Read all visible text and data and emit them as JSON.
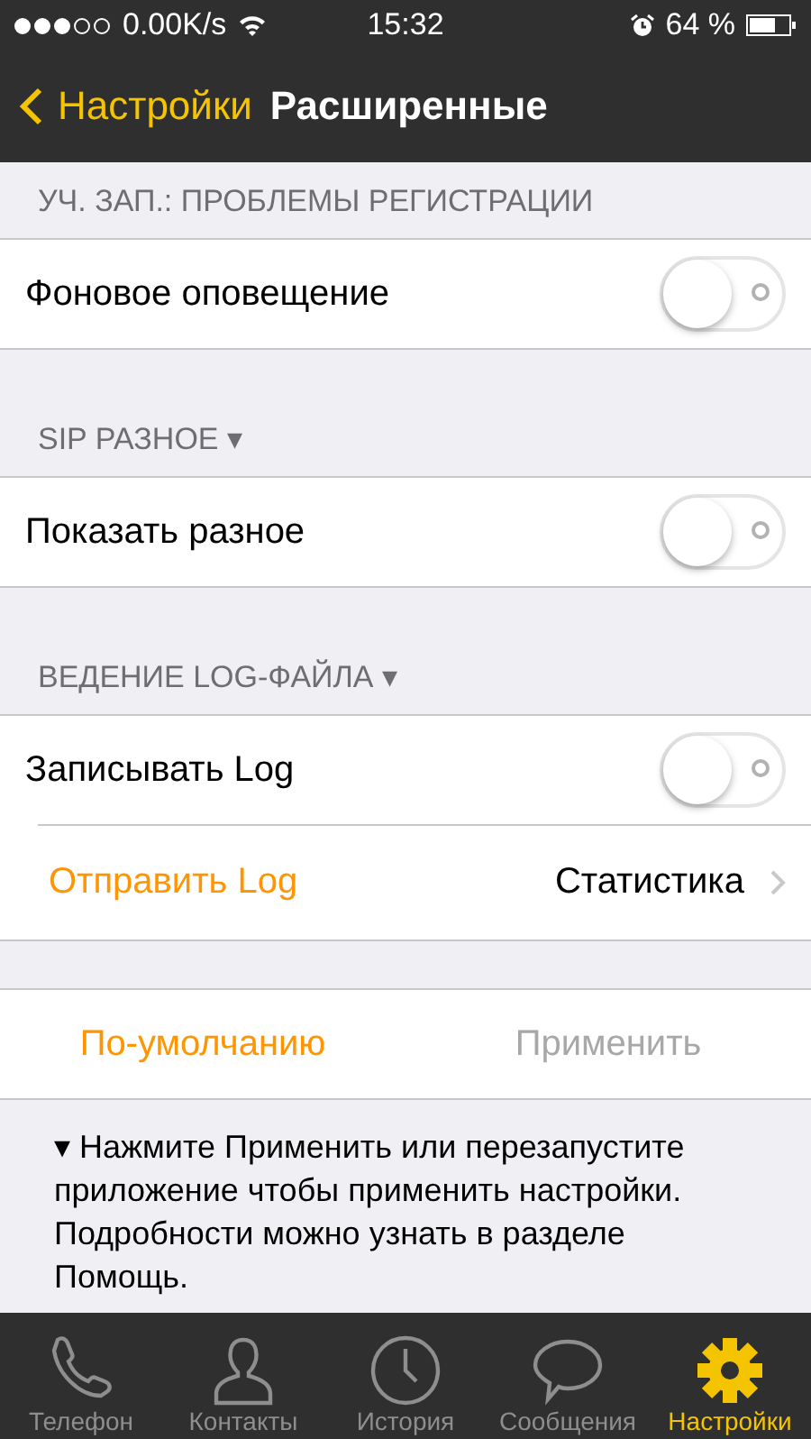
{
  "status_bar": {
    "speed": "0.00K/s",
    "time": "15:32",
    "battery": "64 %"
  },
  "nav": {
    "back": "Настройки",
    "title": "Расширенные"
  },
  "sections": [
    {
      "header": "УЧ. ЗАП.: ПРОБЛЕМЫ РЕГИСТРАЦИИ",
      "rows": [
        {
          "kind": "toggle",
          "label": "Фоновое оповещение",
          "on": false
        }
      ]
    },
    {
      "header": "SIP РАЗНОЕ ▾",
      "rows": [
        {
          "kind": "toggle",
          "label": "Показать разное",
          "on": false
        }
      ]
    },
    {
      "header": "ВЕДЕНИЕ LOG-ФАЙЛА ▾",
      "rows": [
        {
          "kind": "toggle",
          "label": "Записывать Log",
          "on": false
        },
        {
          "kind": "link",
          "label": "Отправить Log",
          "value": "Статистика"
        }
      ]
    }
  ],
  "actions": [
    {
      "label": "По-умолчанию",
      "disabled": false
    },
    {
      "label": "Применить",
      "disabled": true
    }
  ],
  "note": "▾ Нажмите Применить или перезапустите приложение чтобы применить настройки. Подробности можно узнать в разделе Помощь.",
  "tabs": [
    {
      "label": "Телефон",
      "selected": false
    },
    {
      "label": "Контакты",
      "selected": false
    },
    {
      "label": "История",
      "selected": false
    },
    {
      "label": "Сообщения",
      "selected": false
    },
    {
      "label": "Настройки",
      "selected": true
    }
  ]
}
